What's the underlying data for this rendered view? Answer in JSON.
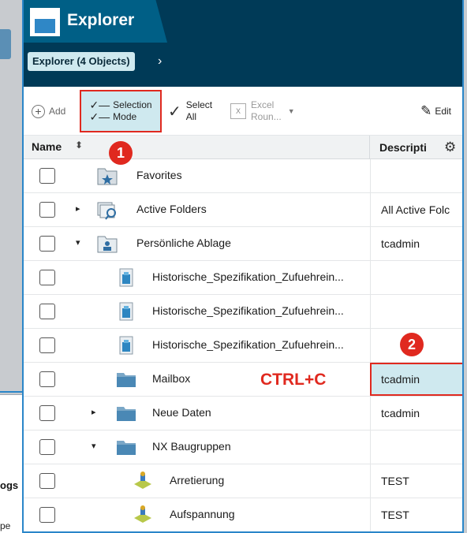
{
  "background": {
    "left_text1": "ogs",
    "left_text2": "pe"
  },
  "header": {
    "title": "Explorer",
    "breadcrumb": "Explorer (4 Objects)",
    "breadcrumb_chevron": "›"
  },
  "toolbar": {
    "add": "Add",
    "selection_mode_l1": "Selection",
    "selection_mode_l2": "Mode",
    "select_all_l1": "Select",
    "select_all_l2": "All",
    "excel_l1": "Excel",
    "excel_l2": "Roun...",
    "edit": "Edit"
  },
  "table": {
    "col_name": "Name",
    "col_desc": "Descripti",
    "rows": [
      {
        "label": "Favorites",
        "desc": "",
        "icon": "favorites-folder-icon",
        "expander": ""
      },
      {
        "label": "Active Folders",
        "desc": "All Active Folc",
        "icon": "active-folders-icon",
        "expander": "▸"
      },
      {
        "label": "Persönliche Ablage",
        "desc": "tcadmin",
        "icon": "home-folder-icon",
        "expander": "▾"
      },
      {
        "label": "Historische_Spezifikation_Zufuehrein...",
        "desc": "",
        "icon": "item-revision-icon",
        "expander": ""
      },
      {
        "label": "Historische_Spezifikation_Zufuehrein...",
        "desc": "",
        "icon": "item-revision-icon",
        "expander": ""
      },
      {
        "label": "Historische_Spezifikation_Zufuehrein...",
        "desc": "",
        "icon": "item-revision-icon",
        "expander": ""
      },
      {
        "label": "Mailbox",
        "desc": "tcadmin",
        "icon": "folder-icon",
        "expander": ""
      },
      {
        "label": "Neue Daten",
        "desc": "tcadmin",
        "icon": "folder-icon",
        "expander": "▸"
      },
      {
        "label": "NX Baugruppen",
        "desc": "",
        "icon": "folder-icon",
        "expander": "▾"
      },
      {
        "label": "Arretierung",
        "desc": "TEST",
        "icon": "assembly-part-icon",
        "expander": ""
      },
      {
        "label": "Aufspannung",
        "desc": "TEST",
        "icon": "assembly-part-icon",
        "expander": ""
      }
    ]
  },
  "annotations": {
    "badge1": "1",
    "badge2": "2",
    "ctrl_c": "CTRL+C",
    "color": "#e0291f"
  }
}
